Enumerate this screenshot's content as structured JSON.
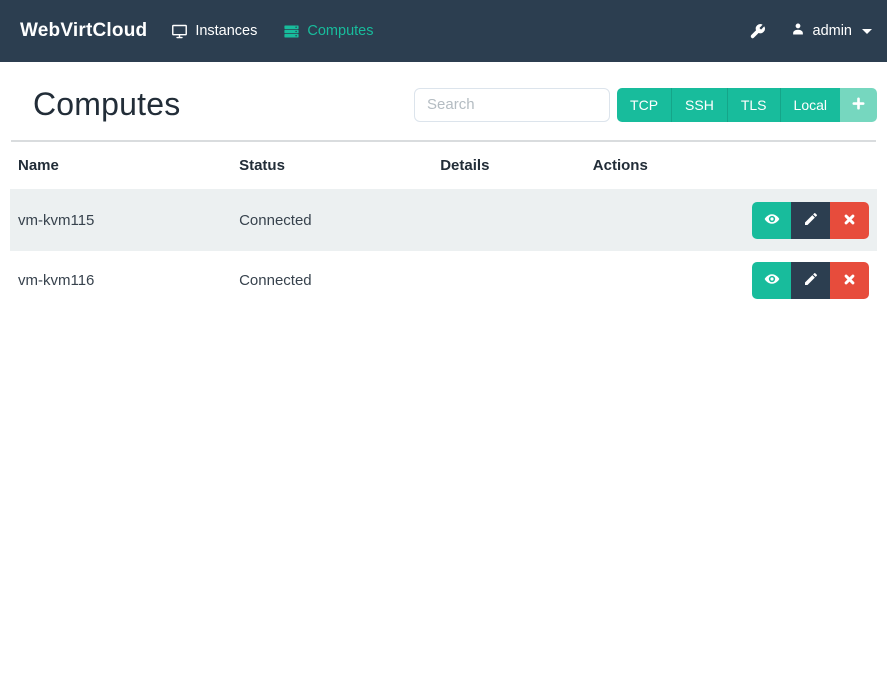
{
  "navbar": {
    "brand": "WebVirtCloud",
    "items": [
      {
        "label": "Instances",
        "icon": "monitor-icon",
        "active": false
      },
      {
        "label": "Computes",
        "icon": "server-icon",
        "active": true
      }
    ],
    "tools_icon": "wrench-icon",
    "user": {
      "icon": "user-icon",
      "label": "admin",
      "caret": "caret-down-icon"
    }
  },
  "page": {
    "title": "Computes"
  },
  "toolbar": {
    "search_placeholder": "Search",
    "type_buttons": [
      "TCP",
      "SSH",
      "TLS",
      "Local"
    ],
    "add_icon": "plus-icon"
  },
  "table": {
    "columns": [
      "Name",
      "Status",
      "Details",
      "Actions"
    ],
    "rows": [
      {
        "name": "vm-kvm115",
        "status": "Connected",
        "details": ""
      },
      {
        "name": "vm-kvm116",
        "status": "Connected",
        "details": ""
      }
    ],
    "row_actions": [
      "view",
      "edit",
      "delete"
    ]
  },
  "colors": {
    "navbar_bg": "#2c3e50",
    "accent_teal": "#18bc9c",
    "accent_teal_light": "#76d7bf",
    "danger_red": "#e74c3c",
    "dark_button": "#2c3e50",
    "stripe_bg": "#ecf0f1"
  }
}
